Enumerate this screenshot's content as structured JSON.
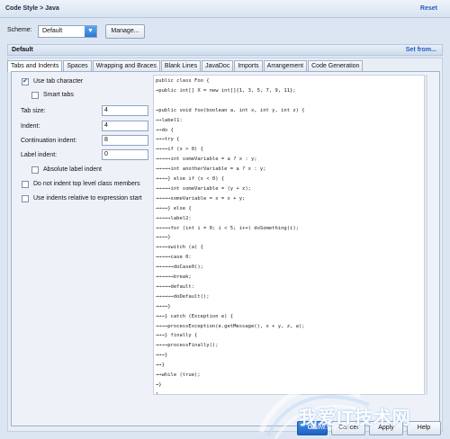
{
  "titlebar": {
    "title": "Code Style > Java",
    "reset": "Reset"
  },
  "scheme": {
    "label": "Scheme:",
    "value": "Default",
    "manage": "Manage..."
  },
  "default_bar": {
    "label": "Default",
    "set_from": "Set from..."
  },
  "tabs": [
    "Tabs and Indents",
    "Spaces",
    "Wrapping and Braces",
    "Blank Lines",
    "JavaDoc",
    "Imports",
    "Arrangement",
    "Code Generation"
  ],
  "options": {
    "use_tab": "Use tab character",
    "smart_tabs": "Smart tabs",
    "absolute_label": "Absolute label indent",
    "no_indent_top": "Do not indent top level class members",
    "relative_indent": "Use indents relative to expression start"
  },
  "fields": {
    "tab_size": {
      "label": "Tab size:",
      "value": "4"
    },
    "indent": {
      "label": "Indent:",
      "value": "4"
    },
    "continuation": {
      "label": "Continuation indent:",
      "value": "8"
    },
    "label_indent": {
      "label": "Label indent:",
      "value": "0"
    }
  },
  "code": [
    "public class Foo {",
    "→public int[] X = new int[]{1, 3, 5, 7, 9, 11};",
    "",
    "→public void foo(boolean a, int x, int y, int z) {",
    "→→label1:",
    "→→do {",
    "→→→try {",
    "→→→→if (x > 0) {",
    "→→→→→int someVariable = a ? x : y;",
    "→→→→→int anotherVariable = a ? x : y;",
    "→→→→} else if (x < 0) {",
    "→→→→→int someVariable = (y + z);",
    "→→→→→someVariable = x = x + y;",
    "→→→→} else {",
    "→→→→→label2:",
    "→→→→→for (int i = 0; i < 5; i++) doSomething(i);",
    "→→→→}",
    "→→→→switch (a) {",
    "→→→→→case 0:",
    "→→→→→→doCase0();",
    "→→→→→→break;",
    "→→→→→default:",
    "→→→→→→doDefault();",
    "→→→→}",
    "→→→} catch (Exception e) {",
    "→→→→processException(e.getMessage(), x + y, z, a);",
    "→→→} finally {",
    "→→→→processFinally();",
    "→→→}",
    "→→}",
    "→→while (true);",
    "→}",
    "}"
  ],
  "buttons": {
    "ok": "OK",
    "cancel": "Cancel",
    "apply": "Apply",
    "help": "Help"
  },
  "watermark": {
    "text": "我爱IT技术网",
    "url": "www.52ij.com"
  }
}
